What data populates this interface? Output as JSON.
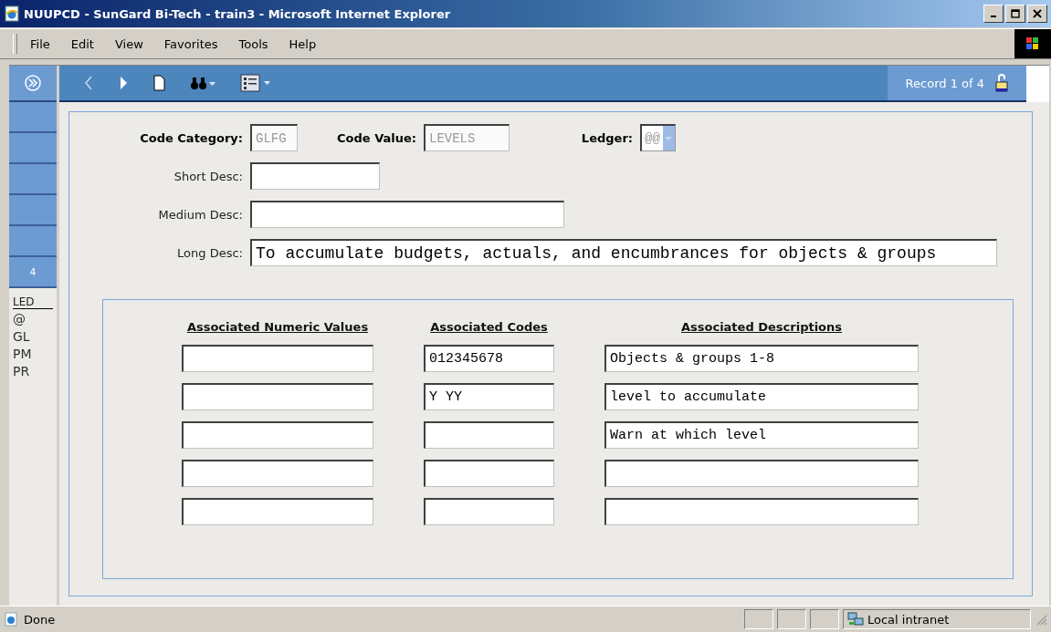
{
  "window": {
    "title": "NUUPCD - SunGard Bi-Tech - train3 - Microsoft Internet Explorer"
  },
  "menu": [
    "File",
    "Edit",
    "View",
    "Favorites",
    "Tools",
    "Help"
  ],
  "toolbar": {
    "record": "Record 1 of 4"
  },
  "sidebar": {
    "tile_label": "4",
    "list_header": "LED",
    "items": [
      "@",
      "GL",
      "PM",
      "PR"
    ]
  },
  "form": {
    "code_category": {
      "label": "Code Category:",
      "value": "GLFG",
      "disabled": true
    },
    "code_value": {
      "label": "Code Value:",
      "value": "LEVELS",
      "disabled": true
    },
    "ledger": {
      "label": "Ledger:",
      "value": "@@",
      "disabled": true
    },
    "fields": [
      {
        "label": "Short Desc:"
      },
      {
        "label": "Medium Desc:"
      },
      {
        "label": "Long Desc:",
        "value": "To accumulate budgets, actuals, and encumbrances for objects & groups"
      }
    ]
  },
  "associated": {
    "columns": [
      "Associated Numeric Values",
      "Associated Codes",
      "Associated Descriptions"
    ],
    "rows": [
      [
        "",
        "012345678",
        "Objects & groups 1-8"
      ],
      [
        "",
        "Y YY",
        "level to accumulate"
      ],
      [
        "",
        "",
        "Warn at which level"
      ],
      [
        "",
        "",
        ""
      ],
      [
        "",
        "",
        ""
      ]
    ]
  },
  "status_bar": {
    "text": "Done",
    "zone": "Local intranet"
  }
}
